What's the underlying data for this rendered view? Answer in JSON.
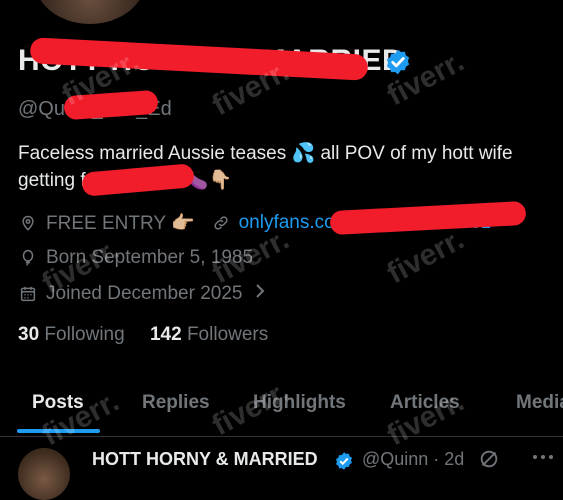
{
  "profile": {
    "display_name": "HOTT HORNY & MARRIED",
    "handle": "@Quinn_and_Ed",
    "bio_line1": "Faceless married Aussie teases 💦 all POV of my hott wife",
    "bio_line2": "getting fucked hard 🍆👇🏼",
    "location": "FREE ENTRY 👉🏼",
    "link": "onlyfans.com/quinnandeddie1",
    "birthday": "Born September 5, 1985",
    "joined": "Joined December 2025",
    "following_count": "30",
    "following_label": "Following",
    "followers_count": "142",
    "followers_label": "Followers"
  },
  "tabs": [
    "Posts",
    "Replies",
    "Highlights",
    "Articles",
    "Media"
  ],
  "post": {
    "author": "HOTT HORNY & MARRIED",
    "handle": "@Quinn · 2d"
  },
  "watermark": "fiverr.",
  "colors": {
    "accent": "#1d9bf0",
    "muted": "#71767b",
    "redaction": "#f21d2a"
  }
}
